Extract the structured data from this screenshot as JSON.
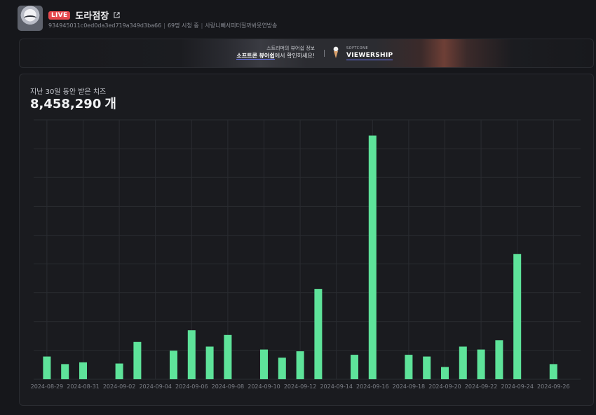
{
  "channel": {
    "live_badge": "LIVE",
    "name": "도라점장",
    "id": "934945011c0ed0da3ed719a349d3ba66",
    "viewers": "69명 시청 중",
    "stream_title": "사랑니빼서피터질까봐못연방송"
  },
  "banner": {
    "line1": "스트리머의 뷰어쉽 정보",
    "line2_strong": "소프트콘 뷰어쉽",
    "line2_rest": "에서 확인하세요!",
    "brand_sub": "SOFTCONE",
    "brand": "VIEWERSHIP"
  },
  "stats": {
    "label": "지난 30일 동안 받은 치즈",
    "total": "8,458,290",
    "unit": "개"
  },
  "colors": {
    "bar": "#5ee39a",
    "live": "#e5484d",
    "accent": "#6d79ff"
  },
  "chart_data": {
    "type": "bar",
    "categories": [
      "2024-08-29",
      "2024-08-30",
      "2024-08-31",
      "2024-09-01",
      "2024-09-02",
      "2024-09-03",
      "2024-09-04",
      "2024-09-05",
      "2024-09-06",
      "2024-09-07",
      "2024-09-08",
      "2024-09-09",
      "2024-09-10",
      "2024-09-11",
      "2024-09-12",
      "2024-09-13",
      "2024-09-14",
      "2024-09-15",
      "2024-09-16",
      "2024-09-17",
      "2024-09-18",
      "2024-09-19",
      "2024-09-20",
      "2024-09-21",
      "2024-09-22",
      "2024-09-23",
      "2024-09-24",
      "2024-09-25",
      "2024-09-26",
      "2024-09-27"
    ],
    "tick_labels": [
      "2024-08-29",
      "2024-08-31",
      "2024-09-02",
      "2024-09-04",
      "2024-09-06",
      "2024-09-08",
      "2024-09-10",
      "2024-09-12",
      "2024-09-14",
      "2024-09-16",
      "2024-09-18",
      "2024-09-20",
      "2024-09-22",
      "2024-09-24",
      "2024-09-26"
    ],
    "values": [
      0.39,
      0.26,
      0.29,
      0,
      0.27,
      0.64,
      0,
      0.49,
      0.84,
      0.56,
      0.76,
      0,
      0.51,
      0.37,
      0.48,
      1.55,
      0,
      0.42,
      4.18,
      0,
      0.42,
      0.39,
      0.21,
      0.56,
      0.51,
      0.67,
      2.15,
      0,
      0.26,
      0
    ],
    "ylim": [
      0,
      4.45
    ],
    "grid": true,
    "title": "",
    "xlabel": "",
    "ylabel": ""
  }
}
